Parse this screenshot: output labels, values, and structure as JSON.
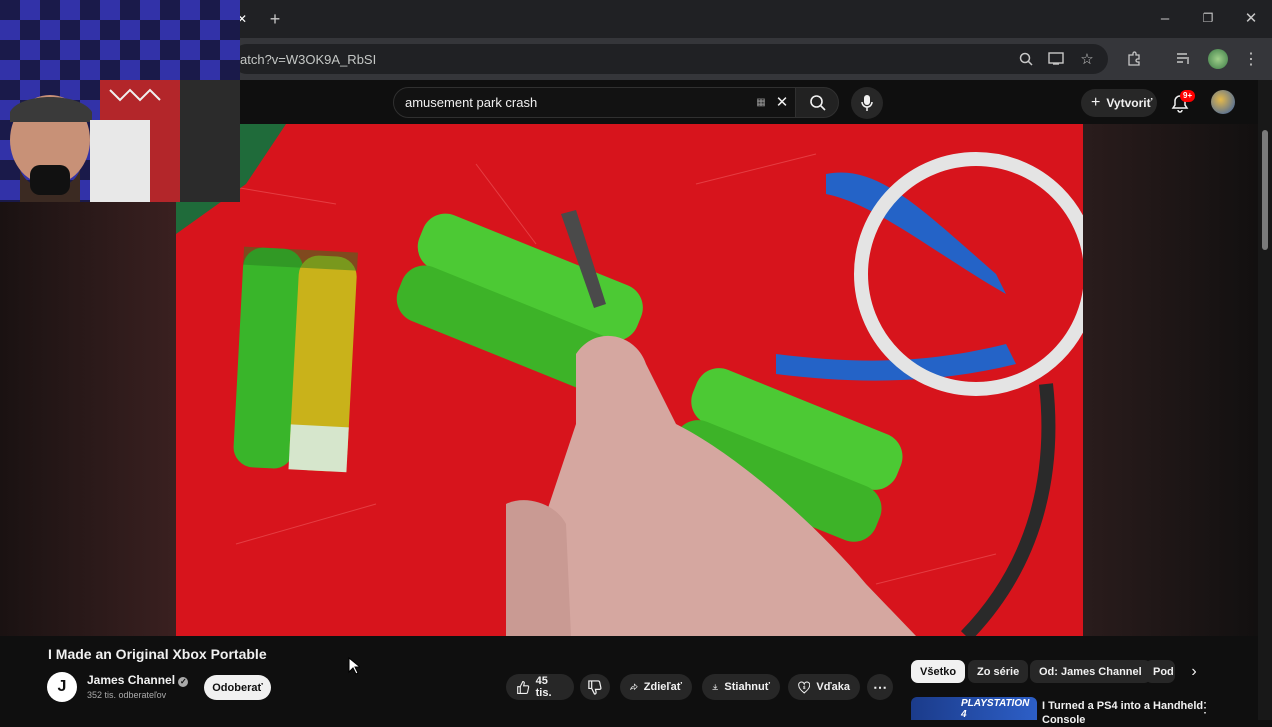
{
  "browser": {
    "url_fragment": "atch?v=W3OK9A_RbSI",
    "new_tab": "+",
    "window_buttons": [
      "minimize-icon",
      "restore-icon",
      "close-icon"
    ]
  },
  "youtube": {
    "search_query": "amusement park crash",
    "create_label": "Vytvoriť",
    "notification_badge": "9+"
  },
  "video": {
    "title": "I Made an Original Xbox Portable",
    "channel": {
      "avatar_letter": "J",
      "name": "James Channel",
      "subscribers": "352 tis. odberateľov",
      "subscribe_label": "Odoberať"
    },
    "actions": {
      "likes": "45 tis.",
      "share": "Zdieľať",
      "download": "Stiahnuť",
      "thanks": "Vďaka"
    }
  },
  "related": {
    "chips": [
      "Všetko",
      "Zo série",
      "Od: James Channel",
      "Pod"
    ],
    "active_chip": "Všetko",
    "items": [
      {
        "thumbnail_text": "PLAYSTATION 4",
        "title": "I Turned a PS4 into a Handheld Console"
      }
    ]
  },
  "colors": {
    "background": "#0f0f0f",
    "video_mat": "#d7141c",
    "battery_green": "#3fbf2a",
    "badge_red": "#ff0000"
  }
}
